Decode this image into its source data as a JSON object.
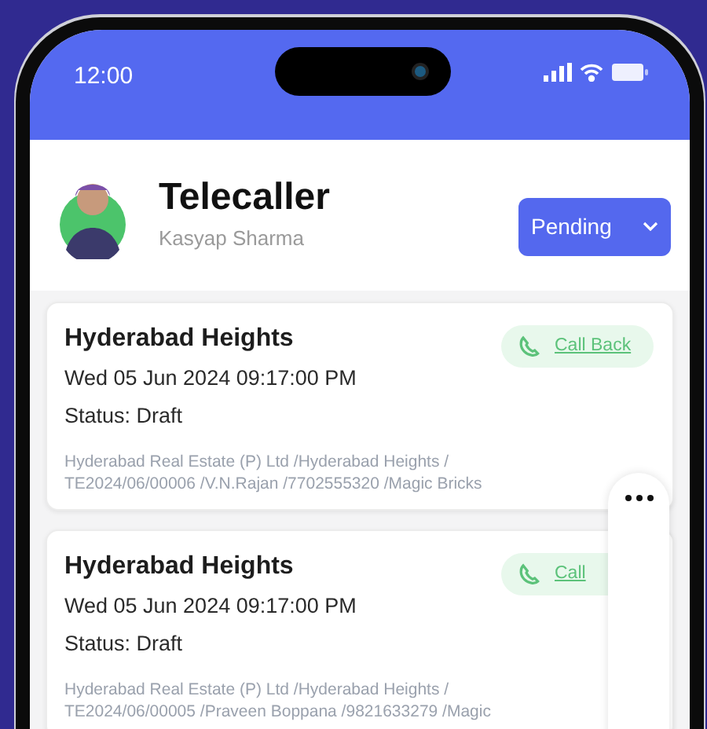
{
  "status_bar": {
    "time": "12:00"
  },
  "profile": {
    "title": "Telecaller",
    "subtitle": "Kasyap Sharma"
  },
  "status_dropdown": {
    "value": "Pending"
  },
  "cards": [
    {
      "title": "Hyderabad Heights",
      "date": "Wed 05 Jun 2024 09:17:00 PM",
      "status": "Status: Draft",
      "action": "Call Back",
      "details": [
        "Hyderabad Real Estate (P) Ltd /Hyderabad Heights /",
        "TE2024/06/00006 /V.N.Rajan /7702555320 /Magic Bricks"
      ]
    },
    {
      "title": "Hyderabad Heights",
      "date": "Wed 05 Jun 2024 09:17:00 PM",
      "status": "Status: Draft",
      "action": "Call",
      "details": [
        "Hyderabad Real Estate (P) Ltd /Hyderabad Heights /",
        "TE2024/06/00005 /Praveen Boppana /9821633279 /Magic"
      ]
    }
  ]
}
